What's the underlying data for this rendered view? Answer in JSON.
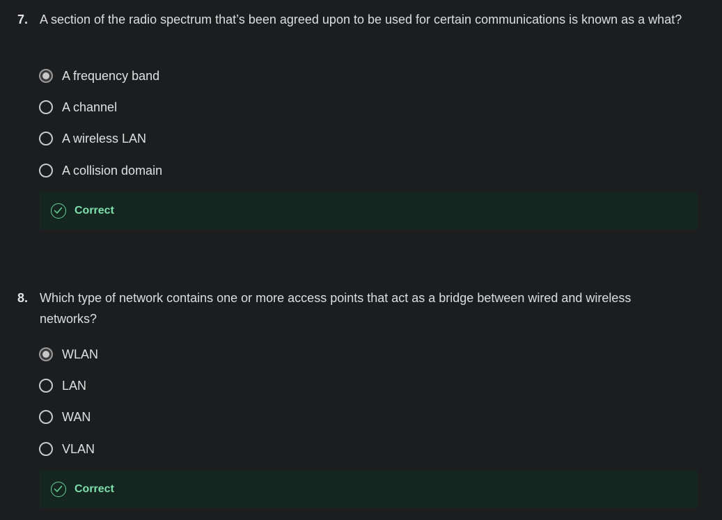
{
  "questions": [
    {
      "number": "7.",
      "text": "A section of the radio spectrum that’s been agreed upon to be used for certain communications is known as a what?",
      "options": [
        {
          "label": "A frequency band",
          "selected": true
        },
        {
          "label": "A channel",
          "selected": false
        },
        {
          "label": "A wireless LAN",
          "selected": false
        },
        {
          "label": "A collision domain",
          "selected": false
        }
      ],
      "feedback": "Correct"
    },
    {
      "number": "8.",
      "text": "Which type of network contains one or more access points that act as a bridge between wired and wireless networks?",
      "options": [
        {
          "label": "WLAN",
          "selected": true
        },
        {
          "label": "LAN",
          "selected": false
        },
        {
          "label": "WAN",
          "selected": false
        },
        {
          "label": "VLAN",
          "selected": false
        }
      ],
      "feedback": "Correct"
    }
  ],
  "colors": {
    "background": "#1c1d1f",
    "feedback_background": "#14261f",
    "feedback_text": "#7de0ad"
  },
  "icons": {
    "correct": "check-circle-icon",
    "radio_selected": "radio-selected-icon",
    "radio_unselected": "radio-unselected-icon"
  }
}
